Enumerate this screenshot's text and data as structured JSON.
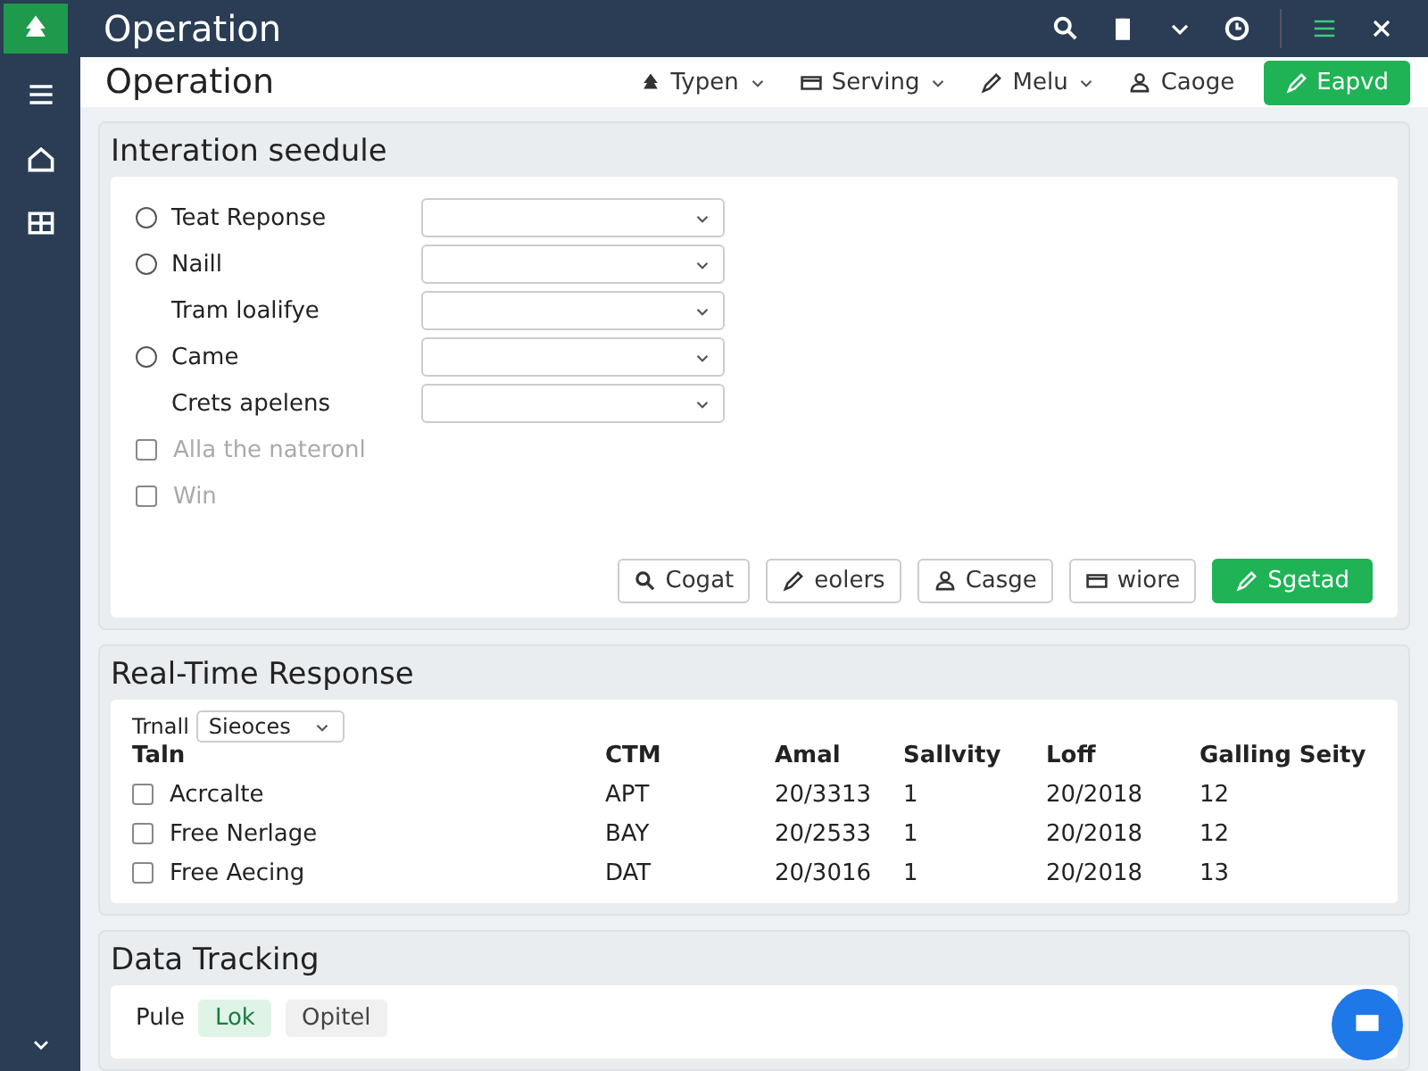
{
  "window": {
    "title": "Operation"
  },
  "header": {
    "title": "Operation",
    "toolbar": [
      {
        "label": "Typen",
        "kind": "dropdown"
      },
      {
        "label": "Serving",
        "kind": "dropdown"
      },
      {
        "label": "Melu",
        "kind": "dropdown"
      },
      {
        "label": "Caoge",
        "kind": "plain"
      },
      {
        "label": "Eapvd",
        "kind": "primary"
      }
    ]
  },
  "schedule": {
    "title": "Interation seedule",
    "fields": [
      {
        "kind": "radio",
        "label": "Teat Reponse",
        "checked": false
      },
      {
        "kind": "radio",
        "label": "Naill",
        "checked": false
      },
      {
        "kind": "plain",
        "label": "Tram loalifye"
      },
      {
        "kind": "radio",
        "label": "Came",
        "checked": false
      },
      {
        "kind": "plain",
        "label": "Crets apelens"
      },
      {
        "kind": "checkbox",
        "label": "Alla the nateronl",
        "checked": false
      },
      {
        "kind": "checkbox",
        "label": "Win",
        "checked": false
      }
    ],
    "buttons": [
      {
        "label": "Cogat",
        "kind": "outline"
      },
      {
        "label": "eolers",
        "kind": "outline"
      },
      {
        "label": "Casge",
        "kind": "outline"
      },
      {
        "label": "wiore",
        "kind": "outline"
      },
      {
        "label": "Sgetad",
        "kind": "primary"
      }
    ]
  },
  "response": {
    "title": "Real-Time Response",
    "filter_label": "Trnall",
    "filter_value": "Sieoces",
    "columns": [
      "Taln",
      "CTM",
      "Amal",
      "Sallvity",
      "Loff",
      "Galling Seity"
    ],
    "rows": [
      {
        "checked": false,
        "cells": [
          "Acrcalte",
          "APT",
          "20/3313",
          "1",
          "20/2018",
          "12"
        ]
      },
      {
        "checked": false,
        "cells": [
          "Free Nerlage",
          "BAY",
          "20/2533",
          "1",
          "20/2018",
          "12"
        ]
      },
      {
        "checked": false,
        "cells": [
          "Free Aecing",
          "DAT",
          "20/3016",
          "1",
          "20/2018",
          "13"
        ]
      }
    ]
  },
  "tracking": {
    "title": "Data Tracking",
    "chips": [
      {
        "label": "Pule",
        "selected": false,
        "kind": "text"
      },
      {
        "label": "Lok",
        "selected": true,
        "kind": "chip"
      },
      {
        "label": "Opitel",
        "selected": false,
        "kind": "chip"
      }
    ]
  }
}
